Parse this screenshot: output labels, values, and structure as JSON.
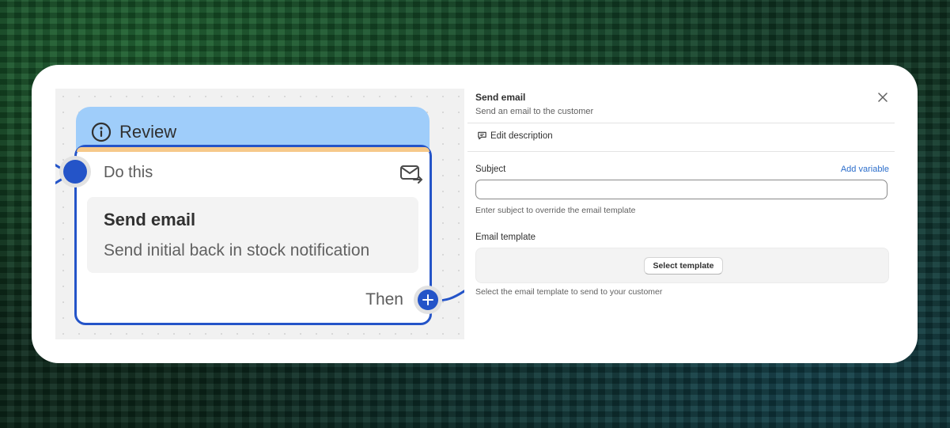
{
  "workflow_node": {
    "header_title": "Review",
    "step_label": "Do this",
    "action_title": "Send email",
    "action_description": "Send initial back in stock notification",
    "next_label": "Then"
  },
  "panel": {
    "title": "Send email",
    "subtitle": "Send an email to the customer",
    "edit_description_label": "Edit description",
    "subject": {
      "label": "Subject",
      "add_variable_label": "Add variable",
      "value": "",
      "help_text": "Enter subject to override the email template"
    },
    "email_template": {
      "label": "Email template",
      "button_label": "Select template",
      "help_text": "Select the email template to send to your customer"
    }
  },
  "colors": {
    "accent_blue": "#2454c8",
    "header_blue": "#9fcdfa",
    "link_blue": "#2c6ecb",
    "node_accent": "#f6c98a"
  },
  "icons": [
    "info-icon",
    "mail-send-icon",
    "plus-icon",
    "close-icon",
    "comment-icon"
  ]
}
